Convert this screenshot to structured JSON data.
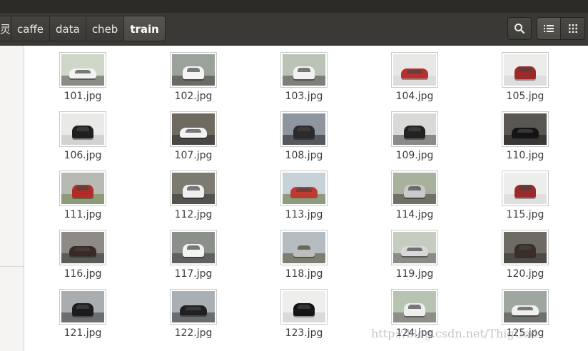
{
  "breadcrumb": [
    "灵",
    "caffe",
    "data",
    "cheb",
    "train"
  ],
  "toolbar": {
    "search_icon": "search-icon",
    "list_icon": "list-view-icon",
    "grid_icon": "grid-view-icon"
  },
  "files": [
    {
      "name": "101.jpg",
      "bg": "#cfd8c8",
      "ground": "#8a8d86",
      "car": "#f2f2f2"
    },
    {
      "name": "102.jpg",
      "bg": "#9aa29a",
      "ground": "#6b6b66",
      "car": "#f4f4f4"
    },
    {
      "name": "103.jpg",
      "bg": "#b9c4b7",
      "ground": "#7c7f7a",
      "car": "#f1f1f1"
    },
    {
      "name": "104.jpg",
      "bg": "#e7e7e5",
      "ground": "#dcdcda",
      "car": "#b8302e"
    },
    {
      "name": "105.jpg",
      "bg": "#ececea",
      "ground": "#dededc",
      "car": "#9d2a28"
    },
    {
      "name": "106.jpg",
      "bg": "#e9e9e7",
      "ground": "#d2d2d0",
      "car": "#1f1f20"
    },
    {
      "name": "107.jpg",
      "bg": "#6f6a5f",
      "ground": "#4a4844",
      "car": "#f2f2f2"
    },
    {
      "name": "108.jpg",
      "bg": "#8d969f",
      "ground": "#55585c",
      "car": "#2b2b2d"
    },
    {
      "name": "109.jpg",
      "bg": "#d9d9d7",
      "ground": "#8a8a88",
      "car": "#222223"
    },
    {
      "name": "110.jpg",
      "bg": "#5a5652",
      "ground": "#3a3836",
      "car": "#141414"
    },
    {
      "name": "111.jpg",
      "bg": "#b7b9b2",
      "ground": "#8f9a76",
      "car": "#b52a26"
    },
    {
      "name": "112.jpg",
      "bg": "#7d7a70",
      "ground": "#55534d",
      "car": "#efefef"
    },
    {
      "name": "113.jpg",
      "bg": "#c7d2d8",
      "ground": "#8f9b7e",
      "car": "#c03a30"
    },
    {
      "name": "114.jpg",
      "bg": "#a7b19c",
      "ground": "#6f7168",
      "car": "#c9c9c9"
    },
    {
      "name": "115.jpg",
      "bg": "#ededeb",
      "ground": "#e0e0de",
      "car": "#9c2a2a"
    },
    {
      "name": "116.jpg",
      "bg": "#8e8b86",
      "ground": "#5d5b58",
      "car": "#3a2a24"
    },
    {
      "name": "117.jpg",
      "bg": "#8b908a",
      "ground": "#5f615e",
      "car": "#f2f2f2"
    },
    {
      "name": "118.jpg",
      "bg": "#b4bcc2",
      "ground": "#7c8072",
      "car": "#bdbdbd"
    },
    {
      "name": "119.jpg",
      "bg": "#c4cdbf",
      "ground": "#8b8c86",
      "car": "#d8d8d8"
    },
    {
      "name": "120.jpg",
      "bg": "#6e6a64",
      "ground": "#4e4b47",
      "car": "#3b2d28"
    },
    {
      "name": "121.jpg",
      "bg": "#a9adb0",
      "ground": "#6d6e6f",
      "car": "#1c1c1e"
    },
    {
      "name": "122.jpg",
      "bg": "#a8b0b5",
      "ground": "#6b6e70",
      "car": "#202022"
    },
    {
      "name": "123.jpg",
      "bg": "#eeeeec",
      "ground": "#dadad8",
      "car": "#151516"
    },
    {
      "name": "124.jpg",
      "bg": "#b7c4b2",
      "ground": "#8d8f88",
      "car": "#eeeeee"
    },
    {
      "name": "125.jpg",
      "bg": "#9ea6a0",
      "ground": "#6f716c",
      "car": "#f0f0f0"
    }
  ],
  "watermark": "http://blog.csdn.net/ThigGod"
}
